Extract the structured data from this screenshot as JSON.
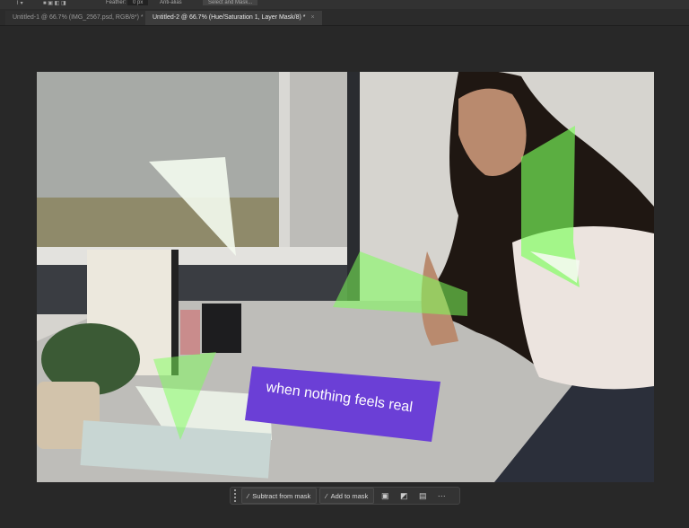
{
  "options_bar": {
    "feather_label": "Feather:",
    "feather_value": "0 px",
    "anti_alias": "Anti-alias",
    "select_mask": "Select and Mask..."
  },
  "tabs": [
    {
      "label": "Untitled-1 @ 66.7% (IMG_2567.psd, RGB/8*) *",
      "active": false
    },
    {
      "label": "Untitled-2 @ 66.7% (Hue/Saturation 1, Layer Mask/8) *",
      "active": true
    }
  ],
  "close_glyph": "×",
  "contextual_taskbar": {
    "subtract": "Subtract from mask",
    "add": "Add to mask",
    "more": "···"
  },
  "colors": {
    "mask_overlay": "#7dff5a",
    "book": "#6b3fd6"
  }
}
